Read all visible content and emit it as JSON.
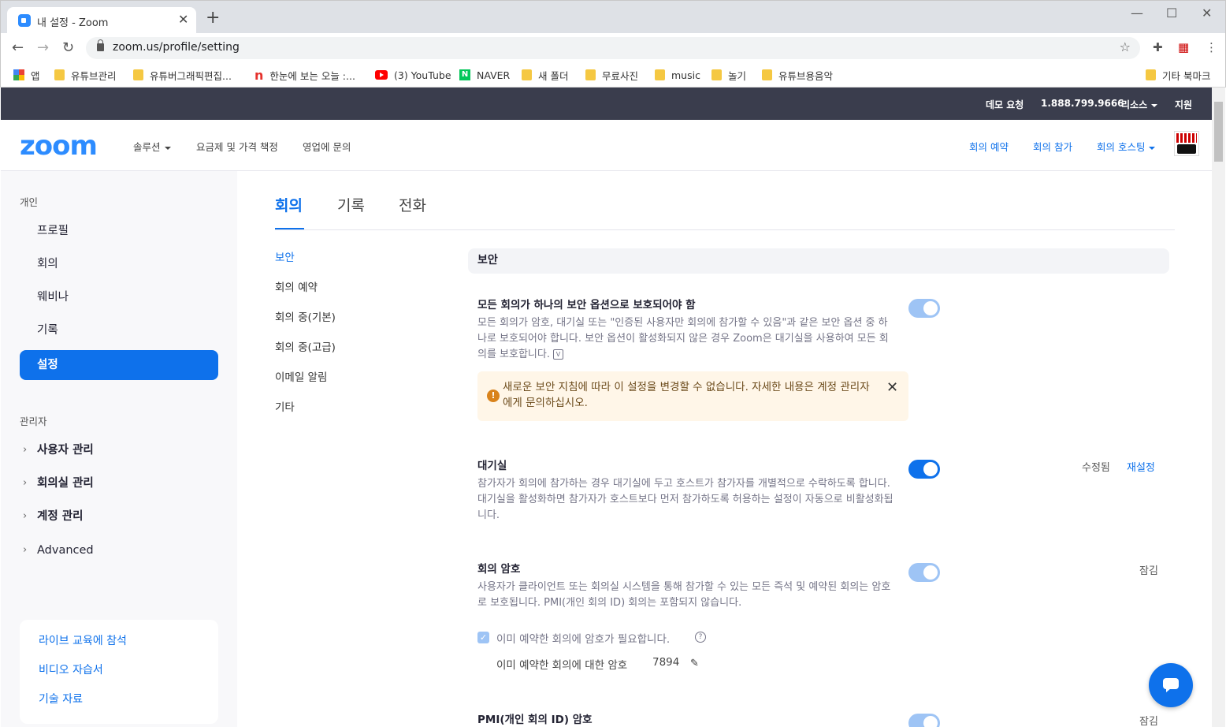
{
  "browser": {
    "tab_title": "내 설정 - Zoom",
    "url": "zoom.us/profile/setting",
    "bookmarks": [
      "앱",
      "유튜브관리",
      "유튜버그래픽편집...",
      "한눈에 보는 오늘 :...",
      "(3) YouTube",
      "NAVER",
      "새 폴더",
      "무료사진",
      "music",
      "놀기",
      "유튜브용음악"
    ],
    "other_bookmarks": "기타 북마크"
  },
  "util": {
    "demo": "데모 요청",
    "phone": "1.888.799.9666",
    "resources": "리소스",
    "support": "지원"
  },
  "header": {
    "logo": "zoom",
    "solutions": "솔루션",
    "pricing": "요금제 및 가격 책정",
    "sales": "영업에 문의",
    "schedule": "회의 예약",
    "join": "회의 참가",
    "host": "회의 호스팅"
  },
  "sidebar": {
    "personal_label": "개인",
    "items": [
      "프로필",
      "회의",
      "웨비나",
      "기록",
      "설정"
    ],
    "admin_label": "관리자",
    "admin_items": [
      "사용자 관리",
      "회의실 관리",
      "계정 관리",
      "Advanced"
    ],
    "help_links": [
      "라이브 교육에 참석",
      "비디오 자습서",
      "기술 자료"
    ]
  },
  "main": {
    "tabs": [
      "회의",
      "기록",
      "전화"
    ],
    "subnav": [
      "보안",
      "회의 예약",
      "회의 중(기본)",
      "회의 중(고급)",
      "이메일 알림",
      "기타"
    ],
    "section_title": "보안",
    "settings": [
      {
        "title": "모든 회의가 하나의 보안 옵션으로 보호되어야 함",
        "desc": "모든 회의가 암호, 대기실 또는 \"인증된 사용자만 회의에 참가할 수 있음\"과 같은 보안 옵션 중 하나로 보호되어야 합니다. 보안 옵션이 활성화되지 않은 경우 Zoom은 대기실을 사용하여 모든 회의를 보호합니다.",
        "desc_badge": "V",
        "state": "locked"
      },
      {
        "title": "대기실",
        "desc": "참가자가 회의에 참가하는 경우 대기실에 두고 호스트가 참가자를 개별적으로 수락하도록 합니다. 대기실을 활성화하면 참가자가 호스트보다 먼저 참가하도록 허용하는 설정이 자동으로 비활성화됩니다.",
        "status": "수정됨",
        "action": "재설정",
        "state": "on"
      },
      {
        "title": "회의 암호",
        "desc": "사용자가 클라이언트 또는 회의실 시스템을 통해 참가할 수 있는 모든 즉석 및 예약된 회의는 암호로 보호됩니다. PMI(개인 회의 ID) 회의는 포함되지 않습니다.",
        "status": "잠김",
        "state": "locked"
      },
      {
        "title": "PMI(개인 회의 ID) 암호",
        "status": "잠김",
        "state": "locked"
      }
    ],
    "notice": "새로운 보안 지침에 따라 이 설정을 변경할 수 없습니다. 자세한 내용은 계정 관리자에게 문의하십시오.",
    "checkbox_label": "이미 예약한 회의에 암호가 필요합니다.",
    "password_label": "이미 예약한 회의에 대한 암호",
    "password_value": "7894"
  },
  "colors": {
    "accent": "#0e71eb",
    "toggle_locked": "#9ec4f5",
    "util_bar": "#3a3d4d",
    "notice_bg": "#fff6e8"
  }
}
